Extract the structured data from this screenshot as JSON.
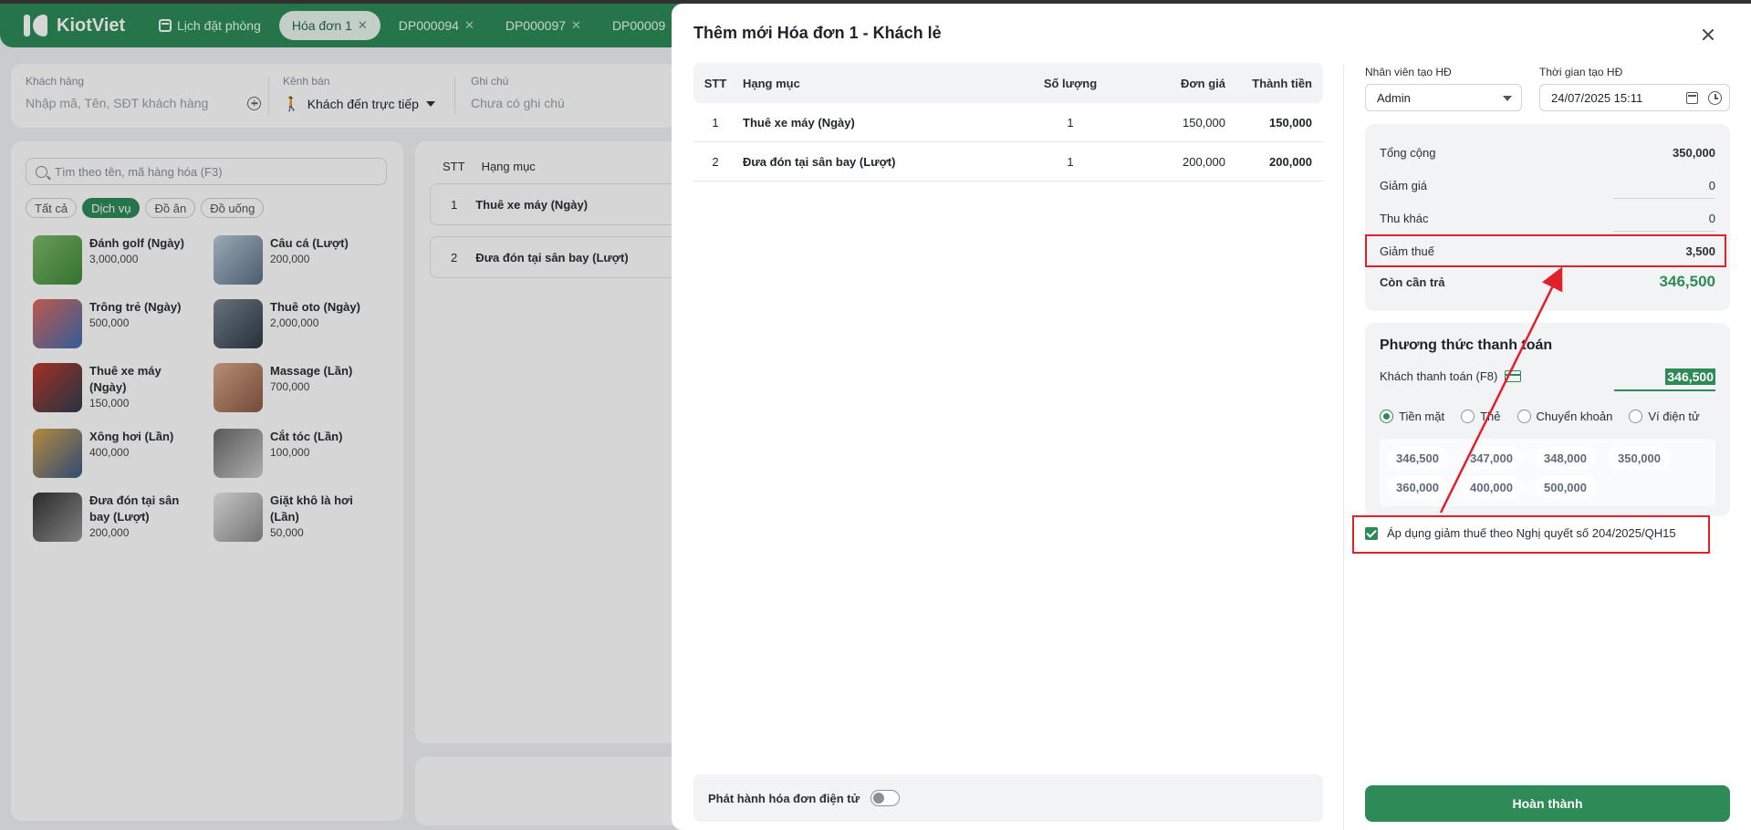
{
  "header": {
    "logo": "KiotViet",
    "tabs": [
      {
        "label": "Lịch đặt phòng"
      },
      {
        "label": "Hóa đơn 1"
      },
      {
        "label": "DP000094"
      },
      {
        "label": "DP000097"
      },
      {
        "label": "DP00009"
      }
    ],
    "close_glyph": "✕"
  },
  "filters": {
    "customer": {
      "label": "Khách hàng",
      "placeholder": "Nhập mã, Tên, SĐT khách hàng"
    },
    "channel": {
      "label": "Kênh bán",
      "value": "Khách đến trực tiếp"
    },
    "note": {
      "label": "Ghi chú",
      "placeholder": "Chưa có ghi chú"
    }
  },
  "catalog": {
    "search_placeholder": "Tìm theo tên, mã hàng hóa (F3)",
    "chips": [
      "Tất cả",
      "Dịch vụ",
      "Đồ ăn",
      "Đồ uống"
    ],
    "products": [
      {
        "name": "Đánh golf (Ngày)",
        "price": "3,000,000"
      },
      {
        "name": "Câu cá (Lượt)",
        "price": "200,000"
      },
      {
        "name": "Trông trẻ (Ngày)",
        "price": "500,000"
      },
      {
        "name": "Thuê oto (Ngày)",
        "price": "2,000,000"
      },
      {
        "name": "Thuê xe máy (Ngày)",
        "price": "150,000"
      },
      {
        "name": "Massage (Lần)",
        "price": "700,000"
      },
      {
        "name": "Xông hơi (Lần)",
        "price": "400,000"
      },
      {
        "name": "Cắt tóc (Lần)",
        "price": "100,000"
      },
      {
        "name": "Đưa đón tại sân bay (Lượt)",
        "price": "200,000"
      },
      {
        "name": "Giặt khô là hơi (Lần)",
        "price": "50,000"
      }
    ]
  },
  "cart": {
    "headers": {
      "stt": "STT",
      "item": "Hạng mục"
    },
    "rows": [
      {
        "stt": "1",
        "name": "Thuê xe máy (Ngày)"
      },
      {
        "stt": "2",
        "name": "Đưa đón tại sân bay (Lượt)"
      }
    ]
  },
  "modal": {
    "title": "Thêm mới Hóa đơn 1 - Khách lẻ",
    "table": {
      "headers": {
        "stt": "STT",
        "item": "Hạng mục",
        "qty": "Số lượng",
        "price": "Đơn giá",
        "total": "Thành tiền"
      },
      "rows": [
        {
          "stt": "1",
          "name": "Thuê xe máy (Ngày)",
          "qty": "1",
          "price": "150,000",
          "total": "150,000"
        },
        {
          "stt": "2",
          "name": "Đưa đón tại sân bay (Lượt)",
          "qty": "1",
          "price": "200,000",
          "total": "200,000"
        }
      ]
    },
    "einvoice_label": "Phát hành hóa đơn điện tử",
    "staff": {
      "label": "Nhân viên tạo HĐ",
      "value": "Admin"
    },
    "created_time": {
      "label": "Thời gian tạo HĐ",
      "value": "24/07/2025 15:11"
    },
    "summary": {
      "total": {
        "label": "Tổng cộng",
        "value": "350,000"
      },
      "discount": {
        "label": "Giảm giá",
        "value": "0"
      },
      "other": {
        "label": "Thu khác",
        "value": "0"
      },
      "tax_reduction": {
        "label": "Giảm thuế",
        "value": "3,500"
      },
      "remaining": {
        "label": "Còn cần trả",
        "value": "346,500"
      }
    },
    "payment": {
      "title": "Phương thức thanh toán",
      "customer_pay_label": "Khách thanh toán (F8)",
      "customer_pay_value": "346,500",
      "methods": [
        "Tiền mặt",
        "Thẻ",
        "Chuyển khoản",
        "Ví điện tử"
      ],
      "selected_method": "Tiền mặt",
      "quick_amounts": [
        "346,500",
        "347,000",
        "348,000",
        "350,000",
        "360,000",
        "400,000",
        "500,000"
      ]
    },
    "apply_tax_label": "Áp dụng giảm thuế theo Nghị quyết số 204/2025/QH15",
    "apply_tax_checked": true,
    "done_button": "Hoàn thành"
  },
  "colors": {
    "brand": "#2e8b57",
    "highlight": "#e0202a"
  }
}
